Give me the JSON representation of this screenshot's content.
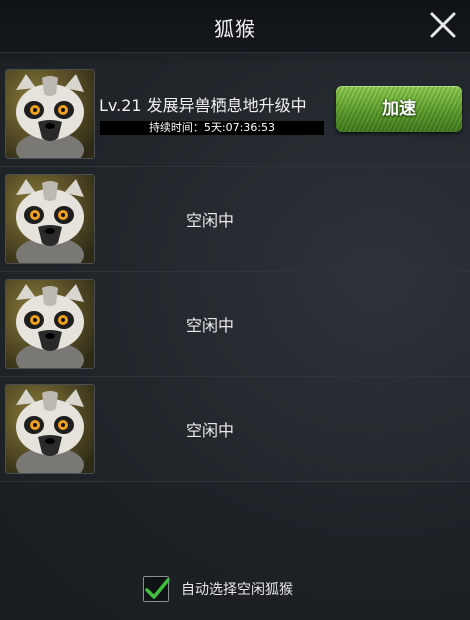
{
  "header": {
    "title": "狐猴"
  },
  "slots": [
    {
      "task": "Lv.21 发展异兽栖息地升级中",
      "timer": "持续时间：5天:07:36:53",
      "button": "加速"
    },
    {
      "status": "空闲中"
    },
    {
      "status": "空闲中"
    },
    {
      "status": "空闲中"
    }
  ],
  "auto_select": {
    "label": "自动选择空闲狐猴",
    "checked": true
  },
  "colors": {
    "accent_green": "#5a9e2a",
    "check_green": "#3fbf3f"
  }
}
